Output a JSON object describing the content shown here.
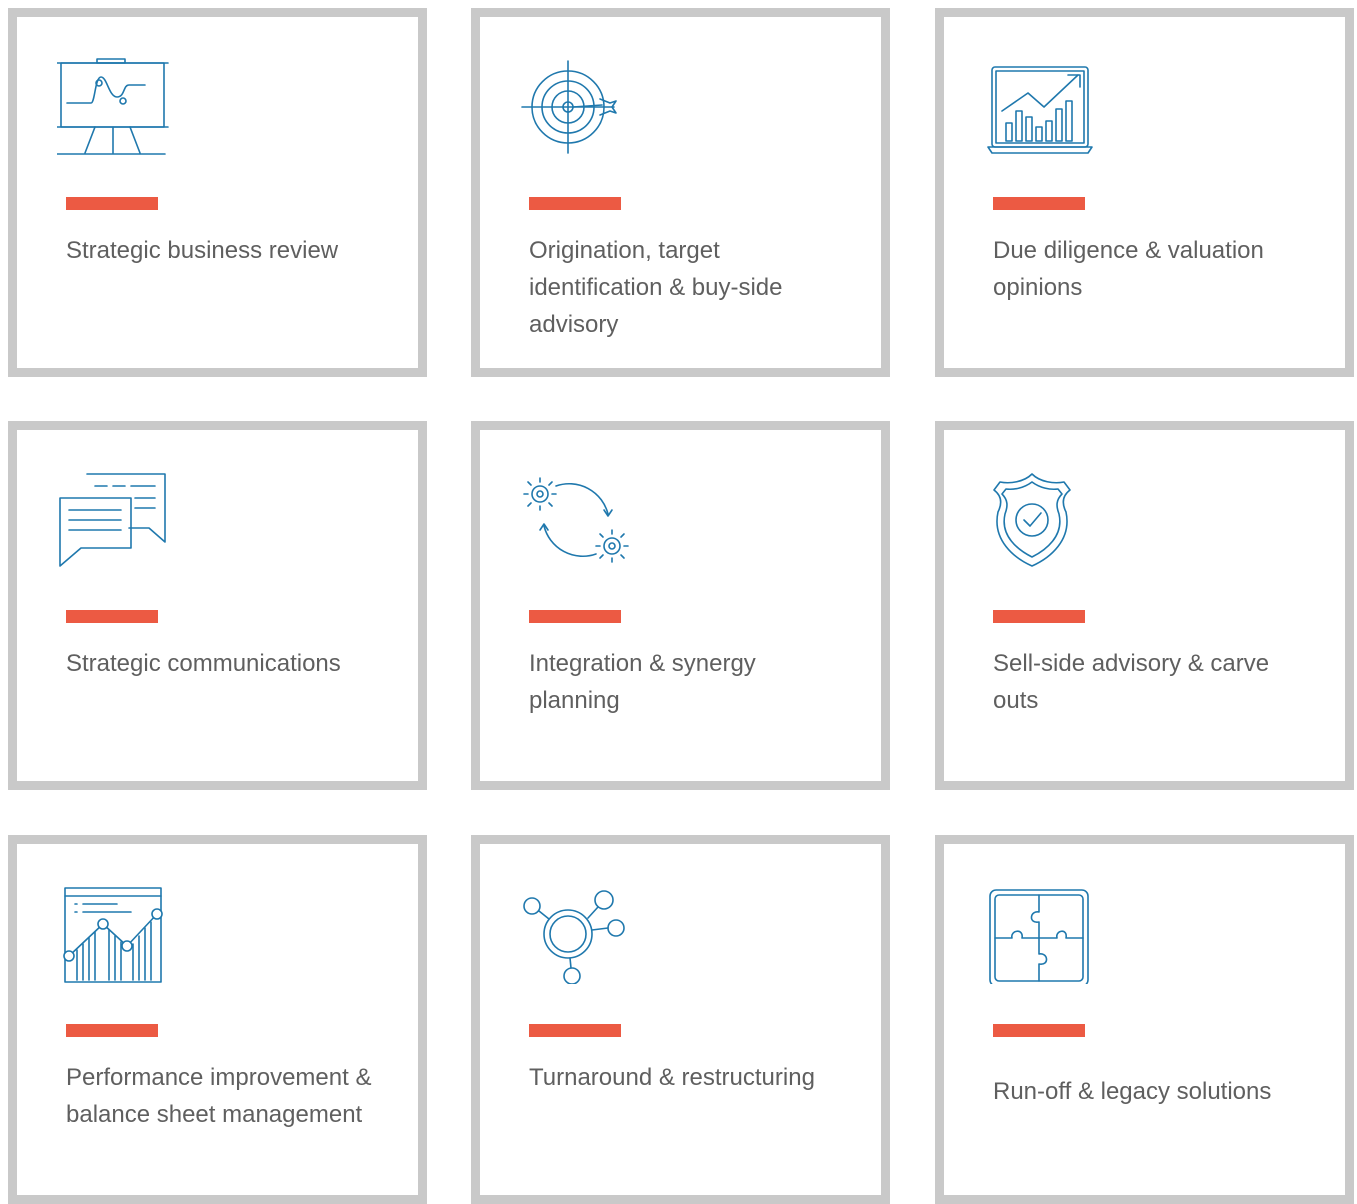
{
  "colors": {
    "accent": "#ec5a43",
    "icon": "#1f78ad",
    "border": "#c9c9c9",
    "text": "#5f5f5f"
  },
  "cards": [
    {
      "label": "Strategic business review",
      "icon": "presentation-board-icon"
    },
    {
      "label": "Origination, target identification & buy-side advisory",
      "icon": "target-dart-icon"
    },
    {
      "label": "Due diligence & valuation opinions",
      "icon": "laptop-growth-chart-icon"
    },
    {
      "label": "Strategic communications",
      "icon": "speech-bubbles-icon"
    },
    {
      "label": "Integration & synergy planning",
      "icon": "gears-cycle-icon"
    },
    {
      "label": "Sell-side advisory & carve outs",
      "icon": "shield-check-icon"
    },
    {
      "label": "Performance improvement & balance sheet management",
      "icon": "performance-chart-icon"
    },
    {
      "label": "Turnaround & restructuring",
      "icon": "network-nodes-icon"
    },
    {
      "label": "Run-off & legacy solutions",
      "icon": "puzzle-icon"
    }
  ]
}
